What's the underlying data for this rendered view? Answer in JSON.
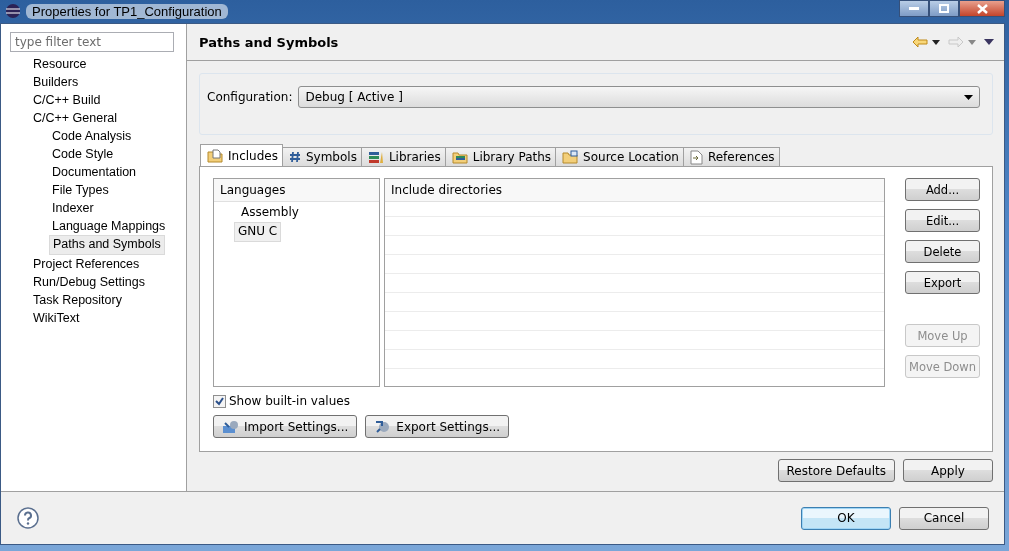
{
  "window": {
    "title": "Properties for TP1_Configuration"
  },
  "filter": {
    "placeholder": "type filter text"
  },
  "tree": [
    {
      "label": "Resource",
      "selected": false
    },
    {
      "label": "Builders",
      "selected": false
    },
    {
      "label": "C/C++ Build",
      "selected": false
    },
    {
      "label": "C/C++ General",
      "selected": false,
      "children": [
        {
          "label": "Code Analysis",
          "selected": false
        },
        {
          "label": "Code Style",
          "selected": false
        },
        {
          "label": "Documentation",
          "selected": false
        },
        {
          "label": "File Types",
          "selected": false
        },
        {
          "label": "Indexer",
          "selected": false
        },
        {
          "label": "Language Mappings",
          "selected": false
        },
        {
          "label": "Paths and Symbols",
          "selected": true
        }
      ]
    },
    {
      "label": "Project References",
      "selected": false
    },
    {
      "label": "Run/Debug Settings",
      "selected": false
    },
    {
      "label": "Task Repository",
      "selected": false
    },
    {
      "label": "WikiText",
      "selected": false
    }
  ],
  "page": {
    "title": "Paths and Symbols",
    "nav": {
      "back_disabled": false,
      "forward_disabled": true
    }
  },
  "configuration": {
    "label": "Configuration:",
    "value": "Debug  [ Active ]"
  },
  "tabs": [
    {
      "label": "Includes",
      "kind": "includes",
      "selected": true
    },
    {
      "label": "Symbols",
      "kind": "symbols",
      "selected": false
    },
    {
      "label": "Libraries",
      "kind": "libraries",
      "selected": false
    },
    {
      "label": "Library Paths",
      "kind": "library-paths",
      "selected": false
    },
    {
      "label": "Source Location",
      "kind": "source",
      "selected": false
    },
    {
      "label": "References",
      "kind": "references",
      "selected": false
    }
  ],
  "languages": {
    "header": "Languages",
    "items": [
      {
        "label": "Assembly",
        "selected": false
      },
      {
        "label": "GNU C",
        "selected": true
      }
    ]
  },
  "directories": {
    "header": "Include directories"
  },
  "side_buttons": [
    {
      "label": "Add...",
      "disabled": false
    },
    {
      "label": "Edit...",
      "disabled": false
    },
    {
      "label": "Delete",
      "disabled": false
    },
    {
      "label": "Export",
      "disabled": false
    },
    {
      "label": "Move Up",
      "disabled": true
    },
    {
      "label": "Move Down",
      "disabled": true
    }
  ],
  "show_builtin": {
    "label": "Show built-in values",
    "checked": true
  },
  "settings_buttons": [
    {
      "label": "Import Settings...",
      "kind": "import"
    },
    {
      "label": "Export Settings...",
      "kind": "export"
    }
  ],
  "page_buttons": [
    "Restore Defaults",
    "Apply"
  ],
  "dialog_buttons": [
    {
      "label": "OK",
      "default": true
    },
    {
      "label": "Cancel",
      "default": false
    }
  ]
}
